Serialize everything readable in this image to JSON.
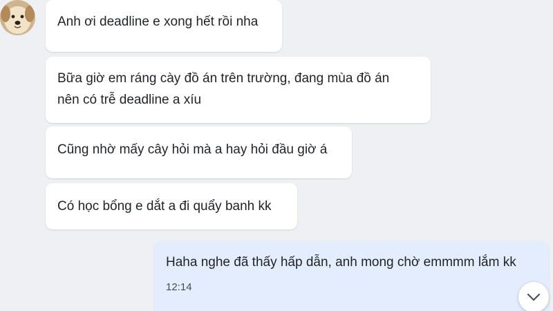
{
  "conversation": {
    "incoming": [
      {
        "lines": [
          "Anh ơi deadline e xong hết rồi nha"
        ]
      },
      {
        "lines": [
          "Bữa giờ em ráng cày đồ án trên trường, đang mùa đồ án",
          "nên có trễ deadline a xíu"
        ]
      },
      {
        "lines": [
          "Cũng nhờ mấy cây hỏi mà a hay hỏi đầu giờ á"
        ]
      },
      {
        "lines": [
          "Có học bổng e dắt a đi quẩy banh kk"
        ]
      }
    ],
    "outgoing": {
      "text": "Haha nghe đã thấy hấp dẫn, anh mong chờ emmmm lắm kk",
      "time": "12:14"
    }
  },
  "icons": {
    "avatar": "dog-avatar",
    "scroll_down": "chevron-down-icon"
  },
  "colors": {
    "background": "#eef0f3",
    "incoming_bubble": "#ffffff",
    "outgoing_bubble": "#e4edfd",
    "text": "#1f2328",
    "timestamp": "#444a52"
  }
}
